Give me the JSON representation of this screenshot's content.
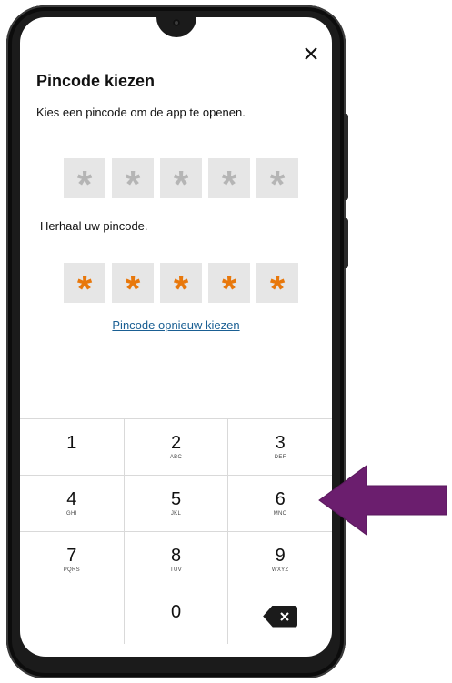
{
  "screen": {
    "title": "Pincode kiezen",
    "subtitle": "Kies een pincode om de app te openen.",
    "first_pin": {
      "slots": [
        "*",
        "*",
        "*",
        "*",
        "*"
      ],
      "state": "empty"
    },
    "repeat_label": "Herhaal uw pincode.",
    "second_pin": {
      "slots": [
        "*",
        "*",
        "*",
        "*",
        "*"
      ],
      "state": "filled"
    },
    "reset_link": "Pincode opnieuw kiezen",
    "close_icon": "close-icon"
  },
  "keypad": {
    "keys": [
      {
        "digit": "1",
        "letters": ""
      },
      {
        "digit": "2",
        "letters": "ABC"
      },
      {
        "digit": "3",
        "letters": "DEF"
      },
      {
        "digit": "4",
        "letters": "GHI"
      },
      {
        "digit": "5",
        "letters": "JKL"
      },
      {
        "digit": "6",
        "letters": "MNO"
      },
      {
        "digit": "7",
        "letters": "PQRS"
      },
      {
        "digit": "8",
        "letters": "TUV"
      },
      {
        "digit": "9",
        "letters": "WXYZ"
      },
      {
        "digit": "0",
        "letters": ""
      }
    ],
    "backspace_icon": "backspace-icon"
  },
  "annotation": {
    "arrow_color": "#6b1e6e",
    "points_to": "6"
  },
  "colors": {
    "filled_asterisk": "#e8780c",
    "empty_asterisk": "#b5b5b5",
    "link": "#1a5f93",
    "pin_box": "#e6e6e6"
  }
}
